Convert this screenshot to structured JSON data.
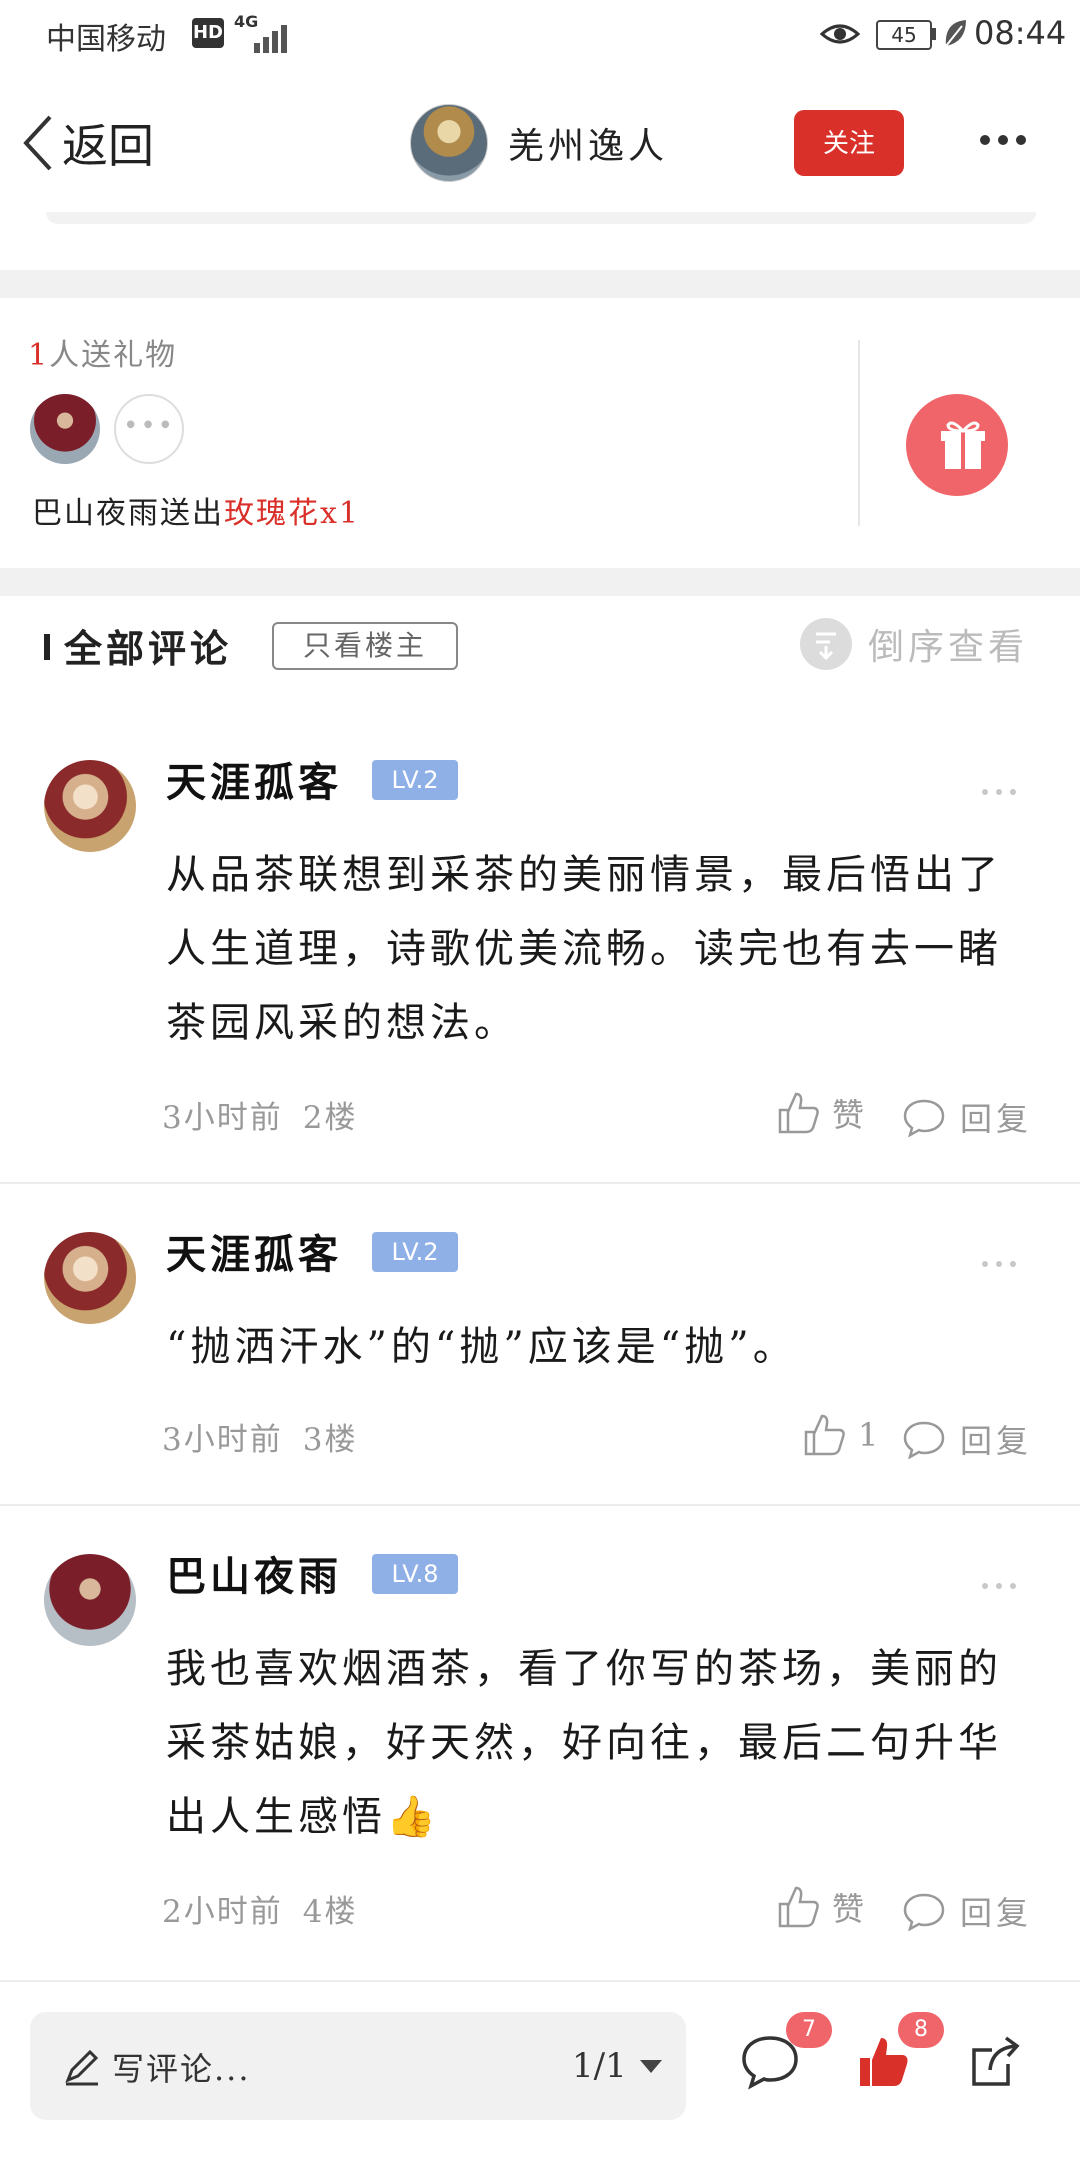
{
  "status_bar": {
    "carrier": "中国移动",
    "hd": "HD",
    "network": "4G",
    "battery": "45",
    "time": "08:44"
  },
  "nav": {
    "back_label": "返回",
    "author_name": "羌州逸人",
    "follow_label": "关注"
  },
  "gifts": {
    "count": "1",
    "count_suffix": "人送礼物",
    "sender": "巴山夜雨",
    "action": "送出",
    "gift_name": "玫瑰花x1"
  },
  "comments_header": {
    "title": "全部评论",
    "filter_label": "只看楼主",
    "sort_label": "倒序查看"
  },
  "comments": [
    {
      "name": "天涯孤客",
      "level": "LV.2",
      "text": "从品茶联想到采茶的美丽情景，最后悟出了人生道理，诗歌优美流畅。读完也有去一睹茶园风采的想法。",
      "time": "3小时前",
      "floor": "2楼",
      "like_label": "赞",
      "reply_label": "回复"
    },
    {
      "name": "天涯孤客",
      "level": "LV.2",
      "text": "“抛洒汗水”的“抛”应该是“抛”。",
      "time": "3小时前",
      "floor": "3楼",
      "like_label": "1",
      "reply_label": "回复"
    },
    {
      "name": "巴山夜雨",
      "level": "LV.8",
      "text": "我也喜欢烟酒茶，看了你写的茶场，美丽的采茶姑娘，好天然，好向往，最后二句升华出人生感悟👍",
      "time": "2小时前",
      "floor": "4楼",
      "like_label": "赞",
      "reply_label": "回复"
    }
  ],
  "bottom_bar": {
    "write_placeholder": "写评论...",
    "page_indicator": "1/1",
    "comment_count": "7",
    "like_count": "8"
  },
  "colors": {
    "accent_red": "#d9302a",
    "badge_pink": "#f0656a",
    "level_blue": "#8fb0e6"
  }
}
